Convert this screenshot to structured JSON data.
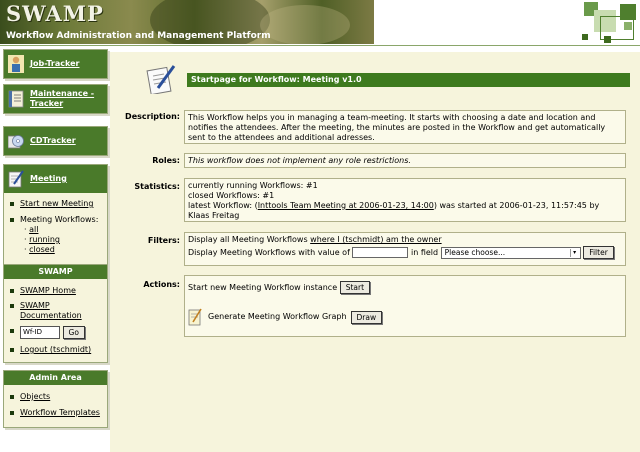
{
  "header": {
    "logo_text": "SWAMP",
    "platform_title": "Workflow Administration and Management Platform"
  },
  "sidebar": {
    "nav_buttons": [
      {
        "label": "Job-Tracker",
        "icon": "person-icon"
      },
      {
        "label": "Maintenance - Tracker",
        "icon": "notebook-icon"
      },
      {
        "label": "CDTracker",
        "icon": "cd-icon"
      }
    ],
    "meeting": {
      "label": "Meeting",
      "icon": "pen-paper-icon",
      "start_new": "Start new Meeting",
      "workflows_label": "Meeting Workflows:",
      "filters": [
        "all",
        "running",
        "closed"
      ]
    },
    "swamp_section": {
      "title": "SWAMP",
      "home": "SWAMP Home",
      "documentation": "SWAMP Documentation",
      "wfid_value": "Wf-ID",
      "go_label": "Go",
      "logout": "Logout (tschmidt)"
    },
    "admin_section": {
      "title": "Admin Area",
      "objects": "Objects",
      "templates": "Workflow Templates"
    }
  },
  "main": {
    "page_title": "Startpage for Workflow: Meeting v1.0",
    "description": {
      "label": "Description:",
      "text": "This Workflow helps you in managing a team-meeting. It starts with choosing a date and location and notifies the attendees. After the meeting, the minutes are posted in the Workflow and get automatically sent to the attendees and additional adresses."
    },
    "roles": {
      "label": "Roles:",
      "text": "This workflow does not implement any role restrictions."
    },
    "statistics": {
      "label": "Statistics:",
      "running": "currently running Workflows: #1",
      "closed": "closed Workflows: #1",
      "latest_prefix": "latest Workflow: (",
      "latest_link": "Inttools Team Meeting at 2006-01-23, 14:00",
      "latest_suffix": ") was started at 2006-01-23, 11:57:45 by Klaas Freitag"
    },
    "filters": {
      "label": "Filters:",
      "line1_prefix": "Display all Meeting Workflows ",
      "line1_link": "where I (tschmidt) am the owner",
      "line2_prefix": "Display Meeting Workflows with value of",
      "line2_mid": "in field",
      "select_value": "Please choose...",
      "button": "Filter"
    },
    "actions": {
      "label": "Actions:",
      "start_text": "Start new Meeting Workflow instance",
      "start_button": "Start",
      "graph_text": "Generate Meeting Workflow Graph",
      "graph_button": "Draw"
    }
  },
  "colors": {
    "accent_green": "#3e7a1e",
    "sidebar_header_green": "#4a7a2a",
    "panel_beige": "#f6f4dc"
  }
}
